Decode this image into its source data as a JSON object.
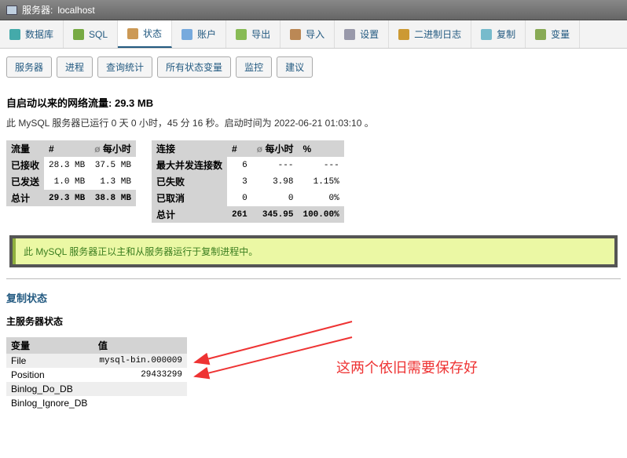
{
  "breadcrumb": {
    "prefix": "服务器:",
    "host": "localhost"
  },
  "topnav": [
    {
      "label": "数据库",
      "name": "tab-databases"
    },
    {
      "label": "SQL",
      "name": "tab-sql"
    },
    {
      "label": "状态",
      "name": "tab-status",
      "active": true
    },
    {
      "label": "账户",
      "name": "tab-accounts"
    },
    {
      "label": "导出",
      "name": "tab-export"
    },
    {
      "label": "导入",
      "name": "tab-import"
    },
    {
      "label": "设置",
      "name": "tab-settings"
    },
    {
      "label": "二进制日志",
      "name": "tab-binlog"
    },
    {
      "label": "复制",
      "name": "tab-replication"
    },
    {
      "label": "变量",
      "name": "tab-variables"
    }
  ],
  "subnav": [
    {
      "label": "服务器"
    },
    {
      "label": "进程"
    },
    {
      "label": "查询统计"
    },
    {
      "label": "所有状态变量"
    },
    {
      "label": "监控"
    },
    {
      "label": "建议"
    }
  ],
  "traffic_heading_prefix": "自启动以来的网络流量:",
  "traffic_total": "29.3 MB",
  "uptime_text": "此 MySQL 服务器已运行 0 天 0 小时，45 分 16 秒。启动时间为 2022-06-21 01:03:10 。",
  "traffic_table": {
    "headers": [
      "流量",
      "#",
      "每小时"
    ],
    "reload_symbol": "ø",
    "rows": [
      {
        "label": "已接收",
        "num": "28.3 MB",
        "per": "37.5 MB"
      },
      {
        "label": "已发送",
        "num": "1.0 MB",
        "per": "1.3 MB"
      }
    ],
    "footer": {
      "label": "总计",
      "num": "29.3 MB",
      "per": "38.8 MB"
    }
  },
  "conn_table": {
    "headers": [
      "连接",
      "#",
      "每小时",
      "%"
    ],
    "reload_symbol": "ø",
    "rows": [
      {
        "label": "最大并发连接数",
        "num": "6",
        "per": "---",
        "pct": "---"
      },
      {
        "label": "已失败",
        "num": "3",
        "per": "3.98",
        "pct": "1.15%"
      },
      {
        "label": "已取消",
        "num": "0",
        "per": "0",
        "pct": "0%"
      }
    ],
    "footer": {
      "label": "总计",
      "num": "261",
      "per": "345.95",
      "pct": "100.00%"
    }
  },
  "notice_text": "此 MySQL 服务器正以主和从服务器运行于复制进程中。",
  "replication_heading": "复制状态",
  "master_heading": "主服务器状态",
  "vars_table": {
    "headers": [
      "变量",
      "值"
    ],
    "rows": [
      {
        "var": "File",
        "val": "mysql-bin.000009"
      },
      {
        "var": "Position",
        "val": "29433299"
      },
      {
        "var": "Binlog_Do_DB",
        "val": ""
      },
      {
        "var": "Binlog_Ignore_DB",
        "val": ""
      }
    ]
  },
  "annotation_text": "这两个依旧需要保存好"
}
